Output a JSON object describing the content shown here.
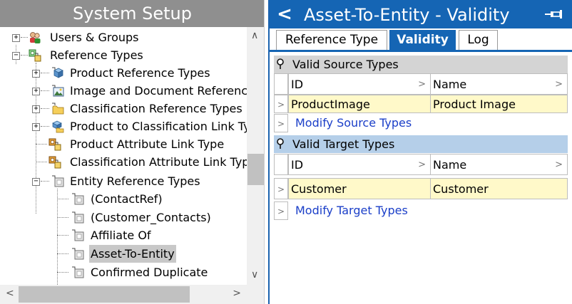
{
  "left_pane": {
    "title": "System Setup",
    "tree": [
      {
        "label": "Users & Groups",
        "expander": "+",
        "icon": "users-groups-icon"
      },
      {
        "label": "Reference Types",
        "expander": "−",
        "icon": "reference-types-icon"
      },
      {
        "label": "Product Reference Types",
        "expander": "+",
        "icon": "product-reference-icon"
      },
      {
        "label": "Image and Document Referenc",
        "expander": "+",
        "icon": "image-document-icon"
      },
      {
        "label": "Classification Reference Types",
        "expander": "+",
        "icon": "folder-icon"
      },
      {
        "label": "Product to Classification Link Ty",
        "expander": "+",
        "icon": "product-classification-link-icon"
      },
      {
        "label": "Product Attribute Link Type",
        "expander": "",
        "icon": "attribute-link-icon"
      },
      {
        "label": "Classification Attribute Link Typ",
        "expander": "",
        "icon": "attribute-link-icon"
      },
      {
        "label": "Entity Reference Types",
        "expander": "−",
        "icon": "entity-reference-icon"
      },
      {
        "label": "(ContactRef)",
        "expander": "",
        "icon": "entity-reference-icon"
      },
      {
        "label": "(Customer_Contacts)",
        "expander": "",
        "icon": "entity-reference-icon"
      },
      {
        "label": "Affiliate Of",
        "expander": "",
        "icon": "entity-reference-icon"
      },
      {
        "label": "Asset-To-Entity",
        "expander": "",
        "icon": "entity-reference-icon",
        "selected": true
      },
      {
        "label": "Confirmed Duplicate",
        "expander": "",
        "icon": "entity-reference-icon"
      }
    ],
    "scroll_up_icon": "chevron-up-icon",
    "scroll_down_icon": "chevron-down-icon",
    "scroll_left_icon": "chevron-left-icon",
    "scroll_right_icon": "chevron-right-icon",
    "scroll_up_glyph": "∧",
    "scroll_down_glyph": "∨",
    "scroll_left_glyph": "<",
    "scroll_right_glyph": ">"
  },
  "right_pane": {
    "title": "Asset-To-Entity - Validity",
    "back_glyph": "<",
    "tabs": [
      {
        "label": "Reference Type",
        "active": false
      },
      {
        "label": "Validity",
        "active": true
      },
      {
        "label": "Log",
        "active": false
      }
    ],
    "source_section": {
      "title": "Valid Source Types",
      "columns": [
        "ID",
        "Name"
      ],
      "rows": [
        {
          "id": "ProductImage",
          "name": "Product Image"
        }
      ],
      "modify_link": "Modify Source Types"
    },
    "target_section": {
      "title": "Valid Target Types",
      "columns": [
        "ID",
        "Name"
      ],
      "rows": [
        {
          "id": "Customer",
          "name": "Customer"
        }
      ],
      "modify_link": "Modify Target Types"
    },
    "row_marker_glyph": ">",
    "sort_glyph": ">"
  },
  "colors": {
    "title_blue": "#1565b4",
    "left_title_gray": "#8f8f8f",
    "data_row_yellow": "#fff9c9",
    "target_header_blue": "#b5cfe9",
    "link_blue": "#1a3ec8"
  }
}
